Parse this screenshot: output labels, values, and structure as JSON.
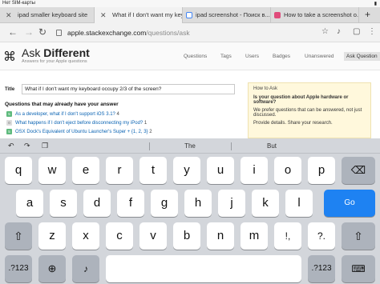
{
  "status": {
    "carrier": "Нет SIM-карты",
    "battery": ""
  },
  "tabs": [
    {
      "title": "ipad smaller keyboard site",
      "active": false
    },
    {
      "title": "What if I don't want my keyb...",
      "active": true
    },
    {
      "title": "ipad screenshot - Поиск в...",
      "active": false
    },
    {
      "title": "How to take a screenshot o...",
      "active": false
    }
  ],
  "browser": {
    "url_host": "apple.stackexchange.com",
    "url_path": "/questions/ask"
  },
  "site": {
    "logo_light": "Ask ",
    "logo_bold": "Different",
    "tagline": "Answers for your Apple questions",
    "nav": [
      "Questions",
      "Tags",
      "Users",
      "Badges",
      "Unanswered",
      "Ask Question"
    ],
    "title_label": "Title",
    "title_value": "What if I don't want my keyboard occupy 2/3 of the screen?",
    "similar_heading": "Questions that may already have your answer",
    "similar": [
      {
        "score": "5",
        "text": "As a developer, what if I don't support iOS 3.1?",
        "count": " 4"
      },
      {
        "score": "0",
        "text": "What happens if I don't eject before disconnecting my iPod?",
        "count": " 1"
      },
      {
        "score": "5",
        "text": "OSX Dock's Equivalent of Ubuntu Launcher's Super + {1, 2, 3}",
        "count": " 2"
      }
    ],
    "howto": {
      "heading": "How to Ask",
      "question": "Is your question about Apple hardware or software?",
      "p1": "We prefer questions that can be answered, not just discussed.",
      "p2": "Provide details. Share your research."
    }
  },
  "keyboard": {
    "suggestions": [
      "",
      "The",
      "But"
    ],
    "row1": [
      "q",
      "w",
      "e",
      "r",
      "t",
      "y",
      "u",
      "i",
      "o",
      "p"
    ],
    "row2": [
      "a",
      "s",
      "d",
      "f",
      "g",
      "h",
      "j",
      "k",
      "l"
    ],
    "row3": [
      "z",
      "x",
      "c",
      "v",
      "b",
      "n",
      "m",
      "!,",
      "?."
    ],
    "go_label": "Go",
    "numbers_label": ".?123"
  }
}
